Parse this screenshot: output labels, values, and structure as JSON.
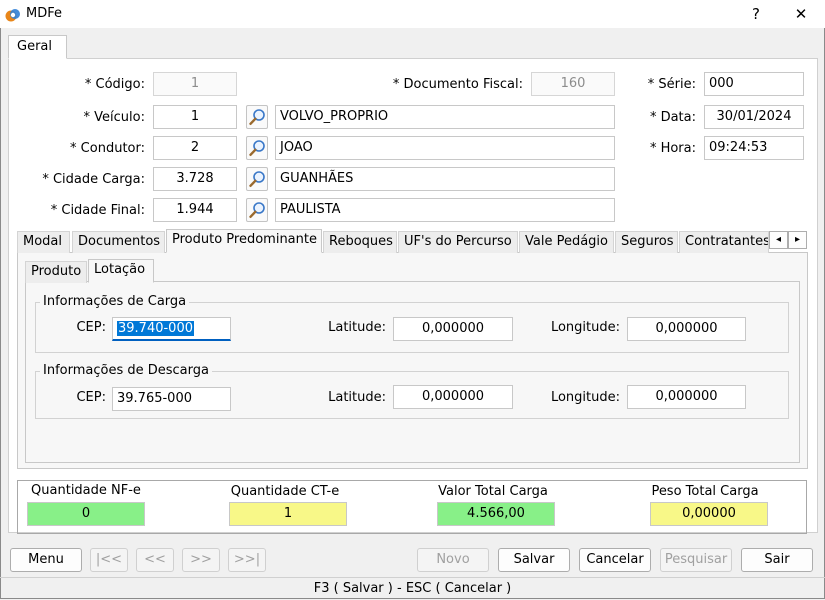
{
  "window": {
    "title": "MDFe",
    "help": "?",
    "close": "✕"
  },
  "tabs_main": [
    {
      "label": "Geral"
    }
  ],
  "form": {
    "codigo": {
      "label": "* Código:",
      "value": "1"
    },
    "documento_fiscal": {
      "label": "* Documento Fiscal:",
      "value": "160"
    },
    "serie": {
      "label": "* Série:",
      "value": "000"
    },
    "veiculo": {
      "label": "* Veículo:",
      "value": "1",
      "name": "VOLVO_PROPRIO"
    },
    "data": {
      "label": "* Data:",
      "value": "30/01/2024"
    },
    "condutor": {
      "label": "* Condutor:",
      "value": "2",
      "name": "JOAO"
    },
    "hora": {
      "label": "* Hora:",
      "value": "09:24:53"
    },
    "cidade_carga": {
      "label": "* Cidade Carga:",
      "value": "3.728",
      "name": "GUANHÃES"
    },
    "cidade_final": {
      "label": "* Cidade Final:",
      "value": "1.944",
      "name": "PAULISTA"
    }
  },
  "tabs_detail": [
    {
      "label": "Modal"
    },
    {
      "label": "Documentos"
    },
    {
      "label": "Produto Predominante"
    },
    {
      "label": "Reboques"
    },
    {
      "label": "UF's do Percurso"
    },
    {
      "label": "Vale Pedágio"
    },
    {
      "label": "Seguros"
    },
    {
      "label": "Contratantes"
    }
  ],
  "tabs_scroll": {
    "left": "◂",
    "right": "▸"
  },
  "tabs_sub": [
    {
      "label": "Produto"
    },
    {
      "label": "Lotação"
    }
  ],
  "carga": {
    "title": "Informações de Carga",
    "cep_label": "CEP:",
    "cep": "39.740-000",
    "lat_label": "Latitude:",
    "lat": "0,000000",
    "lon_label": "Longitude:",
    "lon": "0,000000"
  },
  "descarga": {
    "title": "Informações de Descarga",
    "cep_label": "CEP:",
    "cep": "39.765-000",
    "lat_label": "Latitude:",
    "lat": "0,000000",
    "lon_label": "Longitude:",
    "lon": "0,000000"
  },
  "totals": {
    "nfe": {
      "label": "Quantidade NF-e",
      "value": "0",
      "color": "#88f088"
    },
    "cte": {
      "label": "Quantidade CT-e",
      "value": "1",
      "color": "#f8f888"
    },
    "valor": {
      "label": "Valor Total Carga",
      "value": "4.566,00",
      "color": "#88f088"
    },
    "peso": {
      "label": "Peso Total Carga",
      "value": "0,00000",
      "color": "#f8f888"
    }
  },
  "buttons": {
    "menu": "Menu",
    "first": "|<<",
    "prev": "<<",
    "next": ">>",
    "last": ">>|",
    "novo": "Novo",
    "salvar": "Salvar",
    "cancelar": "Cancelar",
    "pesquisar": "Pesquisar",
    "sair": "Sair"
  },
  "status": "F3 ( Salvar )  -  ESC ( Cancelar )"
}
